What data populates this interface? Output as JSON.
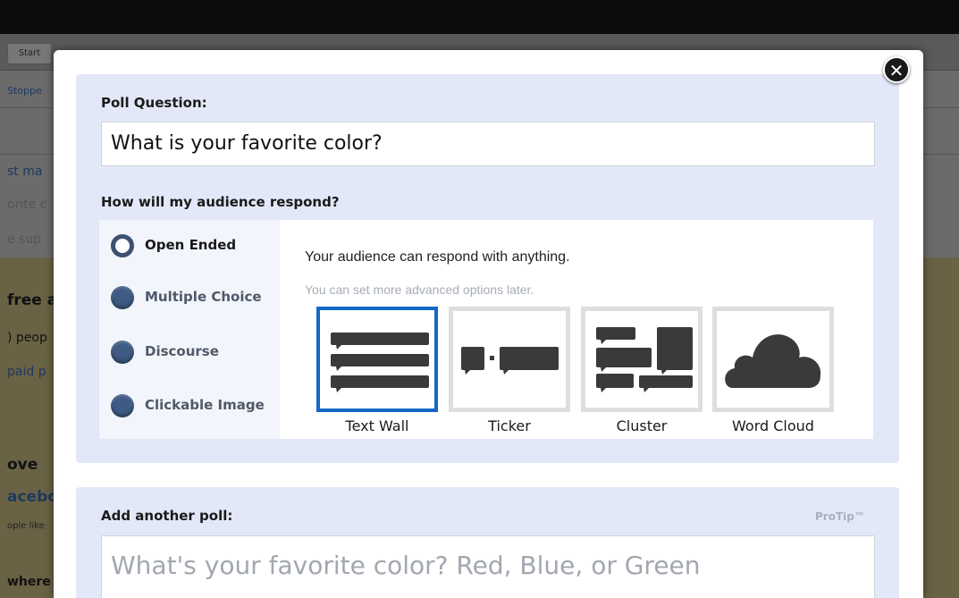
{
  "background": {
    "toolbar_start": "Start",
    "fragments": [
      "Stoppe",
      "st ma",
      "orite c",
      "e sup",
      "free a",
      ") peop",
      "paid p",
      "ove",
      "acebo",
      "ople like",
      "where"
    ]
  },
  "modal": {
    "close_symbol": "✕",
    "poll_question_label": "Poll Question:",
    "poll_question_value": "What is your favorite color?",
    "respond_label": "How will my audience respond?",
    "response_options": [
      {
        "label": "Open Ended",
        "selected": true
      },
      {
        "label": "Multiple Choice",
        "selected": false
      },
      {
        "label": "Discourse",
        "selected": false
      },
      {
        "label": "Clickable Image",
        "selected": false
      }
    ],
    "description": "Your audience can respond with anything.",
    "sub_description": "You can set more advanced options later.",
    "visualizations": [
      {
        "label": "Text Wall",
        "icon": "text-wall-icon",
        "selected": true
      },
      {
        "label": "Ticker",
        "icon": "ticker-icon",
        "selected": false
      },
      {
        "label": "Cluster",
        "icon": "cluster-icon",
        "selected": false
      },
      {
        "label": "Word Cloud",
        "icon": "word-cloud-icon",
        "selected": false
      }
    ],
    "add_poll_label": "Add another poll:",
    "protip": "ProTip™",
    "add_poll_placeholder": "What's your favorite color? Red, Blue, or Green"
  },
  "colors": {
    "panel_bg": "#e3e8f8",
    "selected_border": "#1467c8",
    "icon_fill": "#3a3a3a"
  }
}
